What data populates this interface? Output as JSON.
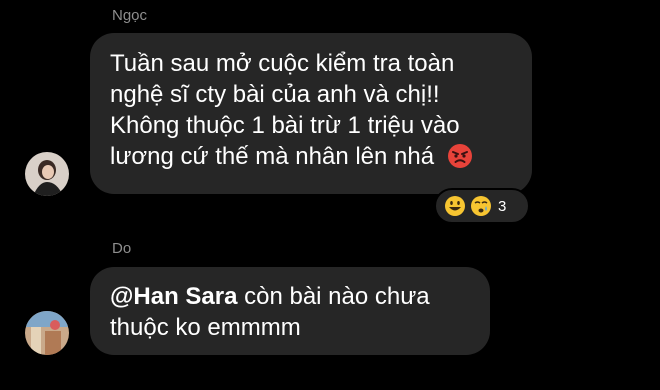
{
  "messages": [
    {
      "sender": "Ngọc",
      "lines": [
        "Tuần sau mở cuộc kiểm tra toàn",
        "nghệ sĩ cty bài của anh và chị!!",
        "Không thuộc 1 bài trừ 1 triệu vào",
        "lương cứ thế mà nhân lên nhá"
      ],
      "inline_emoji": "angry-face-icon",
      "reactions": {
        "icons": [
          "grinning-face-icon",
          "crying-face-icon"
        ],
        "count": "3"
      }
    },
    {
      "sender": "Do",
      "mention": "@Han Sara",
      "lines": [
        " còn bài nào chưa",
        "thuộc ko emmmm"
      ]
    }
  ],
  "colors": {
    "background": "#000000",
    "bubble": "#262626",
    "sender_name": "#8e8e8e",
    "text": "#ffffff",
    "emoji_yellow": "#f7c531",
    "emoji_red": "#e8433a"
  }
}
